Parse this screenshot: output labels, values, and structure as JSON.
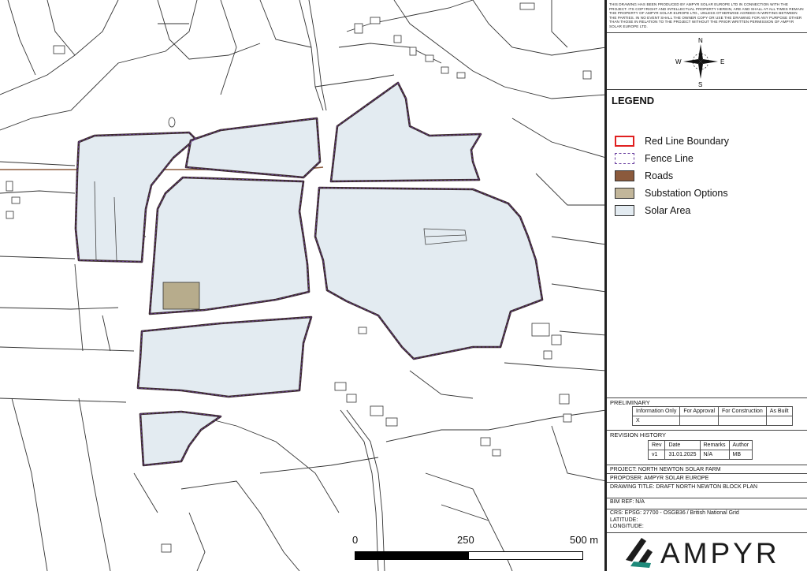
{
  "disclaimer": "This drawing has been produced by Ampyr Solar Europe Ltd in connection with the project. Its copyright and intellectual property herein, are and shall at all times remain the property of Ampyr Solar Europe Ltd., unless otherwise agreed in writing between the parties. In no event shall the owner copy or use the drawing for any purpose other than those in relation to the project without the prior written permission of Ampyr Solar Europe Ltd.",
  "compass": {
    "n": "N",
    "s": "S",
    "e": "E",
    "w": "W"
  },
  "legend": {
    "title": "LEGEND",
    "items": [
      {
        "label": "Red Line Boundary",
        "type": "outline",
        "color": "#e02020"
      },
      {
        "label": "Fence Line",
        "type": "dashed",
        "color": "#6a3fa0"
      },
      {
        "label": "Roads",
        "type": "fill",
        "color": "#8b5a3c"
      },
      {
        "label": "Substation Options",
        "type": "fill",
        "color": "#c2b69a"
      },
      {
        "label": "Solar Area",
        "type": "fill",
        "color": "#e3ebf1"
      }
    ]
  },
  "preliminary": {
    "title": "PRELIMINARY",
    "headers": [
      "Information Only",
      "For Approval",
      "For Construction",
      "As Built"
    ],
    "marks": [
      "X",
      "",
      "",
      ""
    ]
  },
  "revision": {
    "title": "REVISION HISTORY",
    "headers": [
      "Rev",
      "Date",
      "Remarks",
      "Author"
    ],
    "row": [
      "v1",
      "31.01.2025",
      "N/A",
      "MB"
    ]
  },
  "project": "PROJECT: NORTH NEWTON SOLAR FARM",
  "proposer": "PROPOSER: AMPYR SOLAR EUROPE",
  "drawing_title": "DRAWING TITLE: DRAFT NORTH NEWTON BLOCK PLAN",
  "bim_ref": "BIM REF: N/A",
  "crs": "CRS: EPSG: 27700 - OSGB36 / British National Grid",
  "latitude": "LATITUDE:",
  "longitude": "LONGITUDE:",
  "scale": {
    "zero": "0",
    "mid": "250",
    "end": "500 m"
  },
  "brand": "AMPYR",
  "colors": {
    "red_line": "#e02020",
    "fence": "#6a3fa0",
    "road": "#8b5a3c",
    "substation": "#b7ac8c",
    "solar": "#e3ebf1",
    "base_line": "#333333"
  }
}
